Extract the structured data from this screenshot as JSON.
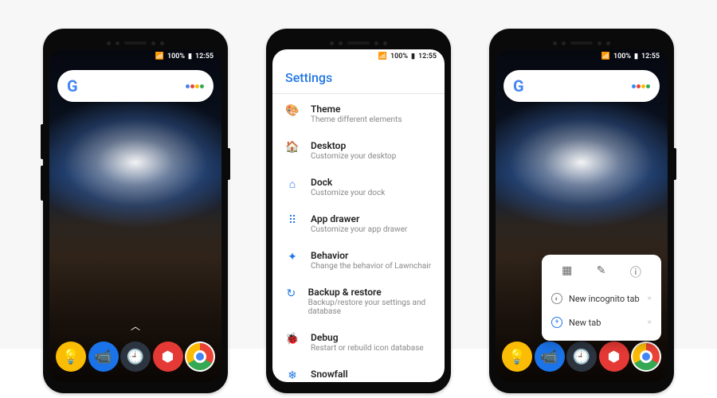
{
  "status": {
    "signal": "📶",
    "battery_pct": "100%",
    "battery_icon": "▮",
    "time": "12:55"
  },
  "phone1": {
    "dock": [
      {
        "name": "tips",
        "glyph": "💡"
      },
      {
        "name": "duo",
        "glyph": "📹"
      },
      {
        "name": "clock",
        "glyph": "🕘"
      },
      {
        "name": "settings",
        "glyph": "⬢"
      },
      {
        "name": "chrome",
        "glyph": ""
      }
    ]
  },
  "phone2": {
    "title": "Settings",
    "items": [
      {
        "icon": "🎨",
        "title": "Theme",
        "sub": "Theme different elements"
      },
      {
        "icon": "🏠",
        "title": "Desktop",
        "sub": "Customize your desktop"
      },
      {
        "icon": "⌂",
        "title": "Dock",
        "sub": "Customize your dock"
      },
      {
        "icon": "⠿",
        "title": "App drawer",
        "sub": "Customize your app drawer"
      },
      {
        "icon": "✦",
        "title": "Behavior",
        "sub": "Change the behavior of Lawnchair"
      },
      {
        "icon": "↻",
        "title": "Backup & restore",
        "sub": "Backup/restore your settings and database"
      },
      {
        "icon": "🐞",
        "title": "Debug",
        "sub": "Restart or rebuild icon database"
      },
      {
        "icon": "❄",
        "title": "Snowfall",
        "sub": ""
      }
    ]
  },
  "phone3": {
    "popup": {
      "top_icons": [
        "▦",
        "✎",
        "ⓘ"
      ],
      "rows": [
        {
          "icon": "◐",
          "label": "New incognito tab",
          "trail": "="
        },
        {
          "icon": "+",
          "label": "New tab",
          "trail": "="
        }
      ]
    }
  }
}
